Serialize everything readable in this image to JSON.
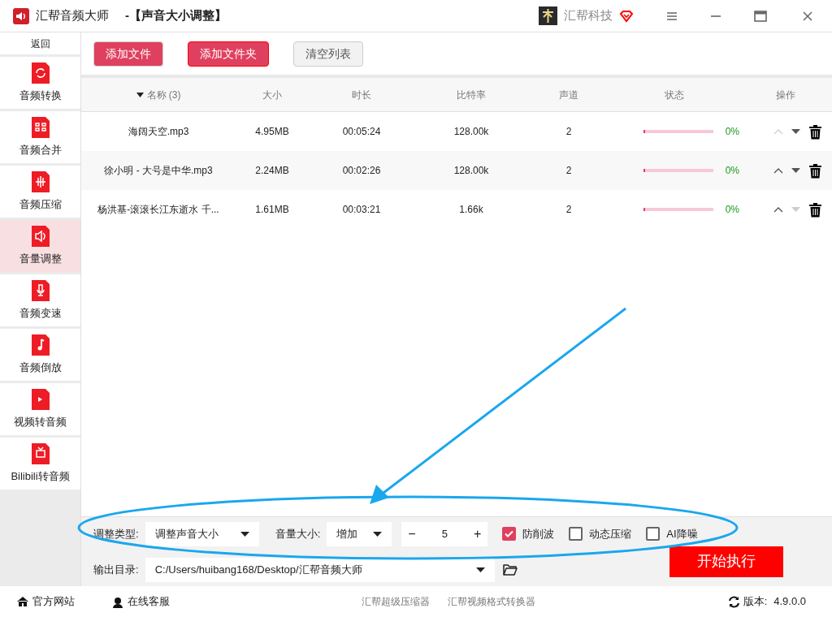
{
  "window": {
    "app_name": "汇帮音频大师",
    "subtitle": "-【声音大小调整】",
    "company": "汇帮科技"
  },
  "sidebar": {
    "back": "返回",
    "items": [
      {
        "label": "音频转换",
        "selected": false
      },
      {
        "label": "音频合并",
        "selected": false
      },
      {
        "label": "音频压缩",
        "selected": false
      },
      {
        "label": "音量调整",
        "selected": true
      },
      {
        "label": "音频变速",
        "selected": false
      },
      {
        "label": "音频倒放",
        "selected": false
      },
      {
        "label": "视频转音频",
        "selected": false
      },
      {
        "label": "Bilibili转音频",
        "selected": false
      }
    ]
  },
  "toolbar": {
    "buttons": [
      {
        "label": "添加文件",
        "kind": "primary"
      },
      {
        "label": "添加文件夹",
        "kind": "primary-outline"
      },
      {
        "label": "清空列表",
        "kind": "plain"
      }
    ]
  },
  "table": {
    "columns": [
      "名称 (3)",
      "大小",
      "时长",
      "比特率",
      "声道",
      "状态",
      "操作"
    ],
    "rows": [
      {
        "name": "海阔天空.mp3",
        "size": "4.95MB",
        "duration": "00:05:24",
        "bitrate": "128.00k",
        "channels": "2",
        "level": 0,
        "percent": "0%",
        "can_move_up": false,
        "can_move_down": true
      },
      {
        "name": "徐小明 - 大号是中华.mp3",
        "size": "2.24MB",
        "duration": "00:02:26",
        "bitrate": "128.00k",
        "channels": "2",
        "level": 0,
        "percent": "0%",
        "can_move_up": true,
        "can_move_down": true
      },
      {
        "name": "杨洪基-滚滚长江东逝水  千...",
        "size": "1.61MB",
        "duration": "00:03:21",
        "bitrate": "1.66k",
        "channels": "2",
        "level": 0,
        "percent": "0%",
        "can_move_up": true,
        "can_move_down": false
      }
    ]
  },
  "settings": {
    "type_label": "调整类型:",
    "type_value": "调整声音大小",
    "volume_label": "音量大小:",
    "volume_mode": "增加",
    "minus": "−",
    "amount": "5",
    "plus": "+",
    "options": [
      {
        "label": "防削波",
        "checked": true
      },
      {
        "label": "动态压缩",
        "checked": false
      },
      {
        "label": "AI降噪",
        "checked": false
      }
    ],
    "output_label": "输出目录:",
    "output_path": "C:/Users/huibang168/Desktop/汇帮音频大师",
    "start": "开始执行"
  },
  "footer": {
    "left": [
      {
        "label": "官方网站"
      },
      {
        "label": "在线客服"
      }
    ],
    "center": [
      "汇帮超级压缩器",
      "汇帮视频格式转换器"
    ],
    "version_label": "版本:",
    "version": "4.9.0.0"
  }
}
